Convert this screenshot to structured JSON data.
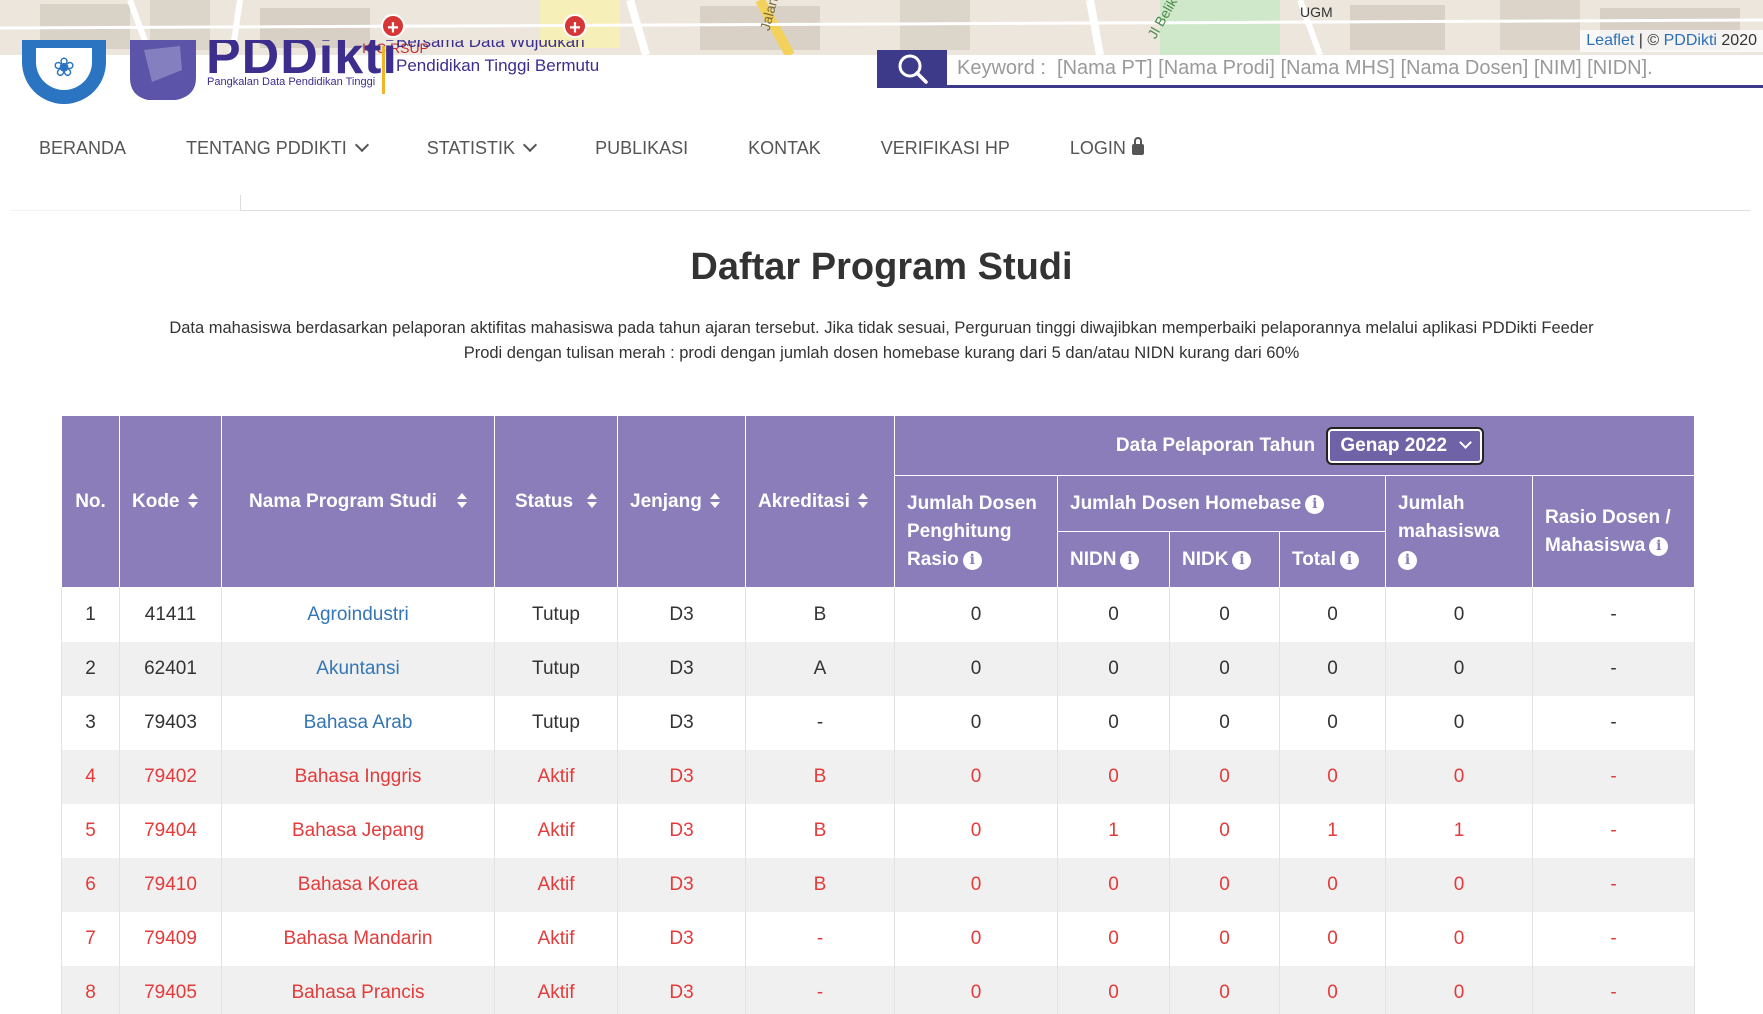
{
  "map": {
    "attribution_leaflet": "Leaflet",
    "attribution_sep": " | © ",
    "attribution_pddikti": "PDDikti",
    "attribution_year": " 2020",
    "labels": [
      "ICC RSUP",
      "UGM",
      "Jalan",
      "Jl Belik"
    ]
  },
  "header": {
    "logo_text": "PDDikti",
    "logo_sub": "Pangkalan Data Pendidikan Tinggi",
    "tagline_1": "Bersama Data Wujudkan",
    "tagline_2": "Pendidikan Tinggi Bermutu",
    "search_placeholder": "Keyword :  [Nama PT] [Nama Prodi] [Nama MHS] [Nama Dosen] [NIM] [NIDN]."
  },
  "nav": [
    {
      "label": "BERANDA",
      "dropdown": false
    },
    {
      "label": "TENTANG PDDIKTI",
      "dropdown": true
    },
    {
      "label": "STATISTIK",
      "dropdown": true
    },
    {
      "label": "PUBLIKASI",
      "dropdown": false
    },
    {
      "label": "KONTAK",
      "dropdown": false
    },
    {
      "label": "VERIFIKASI HP",
      "dropdown": false
    },
    {
      "label": "LOGIN",
      "dropdown": false
    }
  ],
  "page": {
    "title": "Daftar Program Studi",
    "desc_1": "Data mahasiswa berdasarkan pelaporan aktifitas mahasiswa pada tahun ajaran tersebut. Jika tidak sesuai, Perguruan tinggi diwajibkan memperbaiki pelaporannya melalui aplikasi PDDikti Feeder",
    "desc_2": "Prodi dengan tulisan merah : prodi dengan jumlah dosen homebase kurang dari 5 dan/atau NIDN kurang dari 60%"
  },
  "table": {
    "headers": {
      "no": "No.",
      "kode": "Kode",
      "nama": "Nama Program Studi",
      "status": "Status",
      "jenjang": "Jenjang",
      "akreditasi": "Akreditasi",
      "pelaporan": "Data Pelaporan Tahun",
      "year": "Genap 2022",
      "dosen_rasio_1": "Jumlah Dosen",
      "dosen_rasio_2": "Penghitung",
      "dosen_rasio_3": "Rasio",
      "homebase": "Jumlah Dosen Homebase",
      "nidn": "NIDN",
      "nidk": "NIDK",
      "total": "Total",
      "mhs_1": "Jumlah",
      "mhs_2": "mahasiswa",
      "rasio_1": "Rasio Dosen /",
      "rasio_2": "Mahasiswa"
    },
    "rows": [
      {
        "no": "1",
        "kode": "41411",
        "nama": "Agroindustri",
        "status": "Tutup",
        "jenjang": "D3",
        "akreditasi": "B",
        "rasio_dosen": "0",
        "nidn": "0",
        "nidk": "0",
        "total": "0",
        "mahasiswa": "0",
        "rasio": "-",
        "red": false
      },
      {
        "no": "2",
        "kode": "62401",
        "nama": "Akuntansi",
        "status": "Tutup",
        "jenjang": "D3",
        "akreditasi": "A",
        "rasio_dosen": "0",
        "nidn": "0",
        "nidk": "0",
        "total": "0",
        "mahasiswa": "0",
        "rasio": "-",
        "red": false
      },
      {
        "no": "3",
        "kode": "79403",
        "nama": "Bahasa Arab",
        "status": "Tutup",
        "jenjang": "D3",
        "akreditasi": "-",
        "rasio_dosen": "0",
        "nidn": "0",
        "nidk": "0",
        "total": "0",
        "mahasiswa": "0",
        "rasio": "-",
        "red": false
      },
      {
        "no": "4",
        "kode": "79402",
        "nama": "Bahasa Inggris",
        "status": "Aktif",
        "jenjang": "D3",
        "akreditasi": "B",
        "rasio_dosen": "0",
        "nidn": "0",
        "nidk": "0",
        "total": "0",
        "mahasiswa": "0",
        "rasio": "-",
        "red": true
      },
      {
        "no": "5",
        "kode": "79404",
        "nama": "Bahasa Jepang",
        "status": "Aktif",
        "jenjang": "D3",
        "akreditasi": "B",
        "rasio_dosen": "0",
        "nidn": "1",
        "nidk": "0",
        "total": "1",
        "mahasiswa": "1",
        "rasio": "-",
        "red": true
      },
      {
        "no": "6",
        "kode": "79410",
        "nama": "Bahasa Korea",
        "status": "Aktif",
        "jenjang": "D3",
        "akreditasi": "B",
        "rasio_dosen": "0",
        "nidn": "0",
        "nidk": "0",
        "total": "0",
        "mahasiswa": "0",
        "rasio": "-",
        "red": true
      },
      {
        "no": "7",
        "kode": "79409",
        "nama": "Bahasa Mandarin",
        "status": "Aktif",
        "jenjang": "D3",
        "akreditasi": "-",
        "rasio_dosen": "0",
        "nidn": "0",
        "nidk": "0",
        "total": "0",
        "mahasiswa": "0",
        "rasio": "-",
        "red": true
      },
      {
        "no": "8",
        "kode": "79405",
        "nama": "Bahasa Prancis",
        "status": "Aktif",
        "jenjang": "D3",
        "akreditasi": "-",
        "rasio_dosen": "0",
        "nidn": "0",
        "nidk": "0",
        "total": "0",
        "mahasiswa": "0",
        "rasio": "-",
        "red": true
      }
    ]
  },
  "colors": {
    "header_bg": "#8a7dba",
    "brand": "#3d2e8e",
    "link": "#3476b5",
    "warn_red": "#e53a3a"
  }
}
